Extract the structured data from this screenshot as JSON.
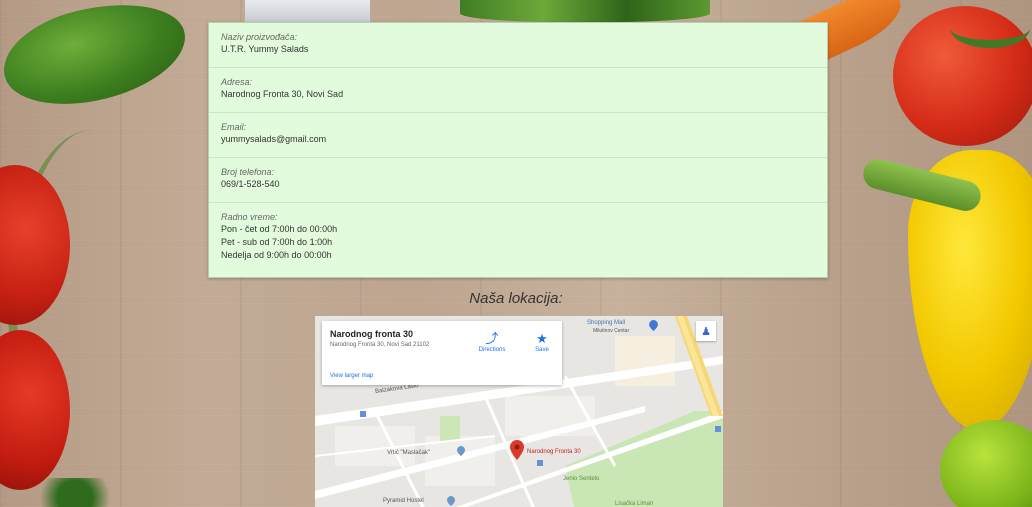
{
  "contact": {
    "producer_label": "Naziv proizvođača:",
    "producer_value": "U.T.R. Yummy Salads",
    "address_label": "Adresa:",
    "address_value": "Narodnog Fronta 30, Novi Sad",
    "email_label": "Email:",
    "email_value": "yummysalads@gmail.com",
    "phone_label": "Broj telefona:",
    "phone_value": "069/1-528-540",
    "hours_label": "Radno vreme:",
    "hours": [
      "Pon - čet od 7:00h do 00:00h",
      "Pet - sub od 7:00h do 1:00h",
      "Nedelja od 9:00h do 00:00h"
    ]
  },
  "location_title": "Naša lokacija:",
  "map": {
    "place_name": "Narodnog fronta 30",
    "place_address": "Narodnog Fronta 30, Novi Sad 21102",
    "view_larger": "View larger map",
    "directions_label": "Directions",
    "save_label": "Save",
    "marker_label": "Narodnog Fronta 30",
    "poi_mall": "Shopping Mall",
    "poi_mall_sub": "Milutinov Centar",
    "poi_vrtic": "Vrtić \"Maslačak\"",
    "poi_hostel": "Pyramid Hostel",
    "street_1": "Balzakova Laslo",
    "poi_park": "Jenio Sentelo",
    "poi_park2": "Lisačka Liman"
  },
  "colors": {
    "card_bg": "#e1fbdc",
    "link": "#1a73e8",
    "marker": "#db3a2b"
  }
}
